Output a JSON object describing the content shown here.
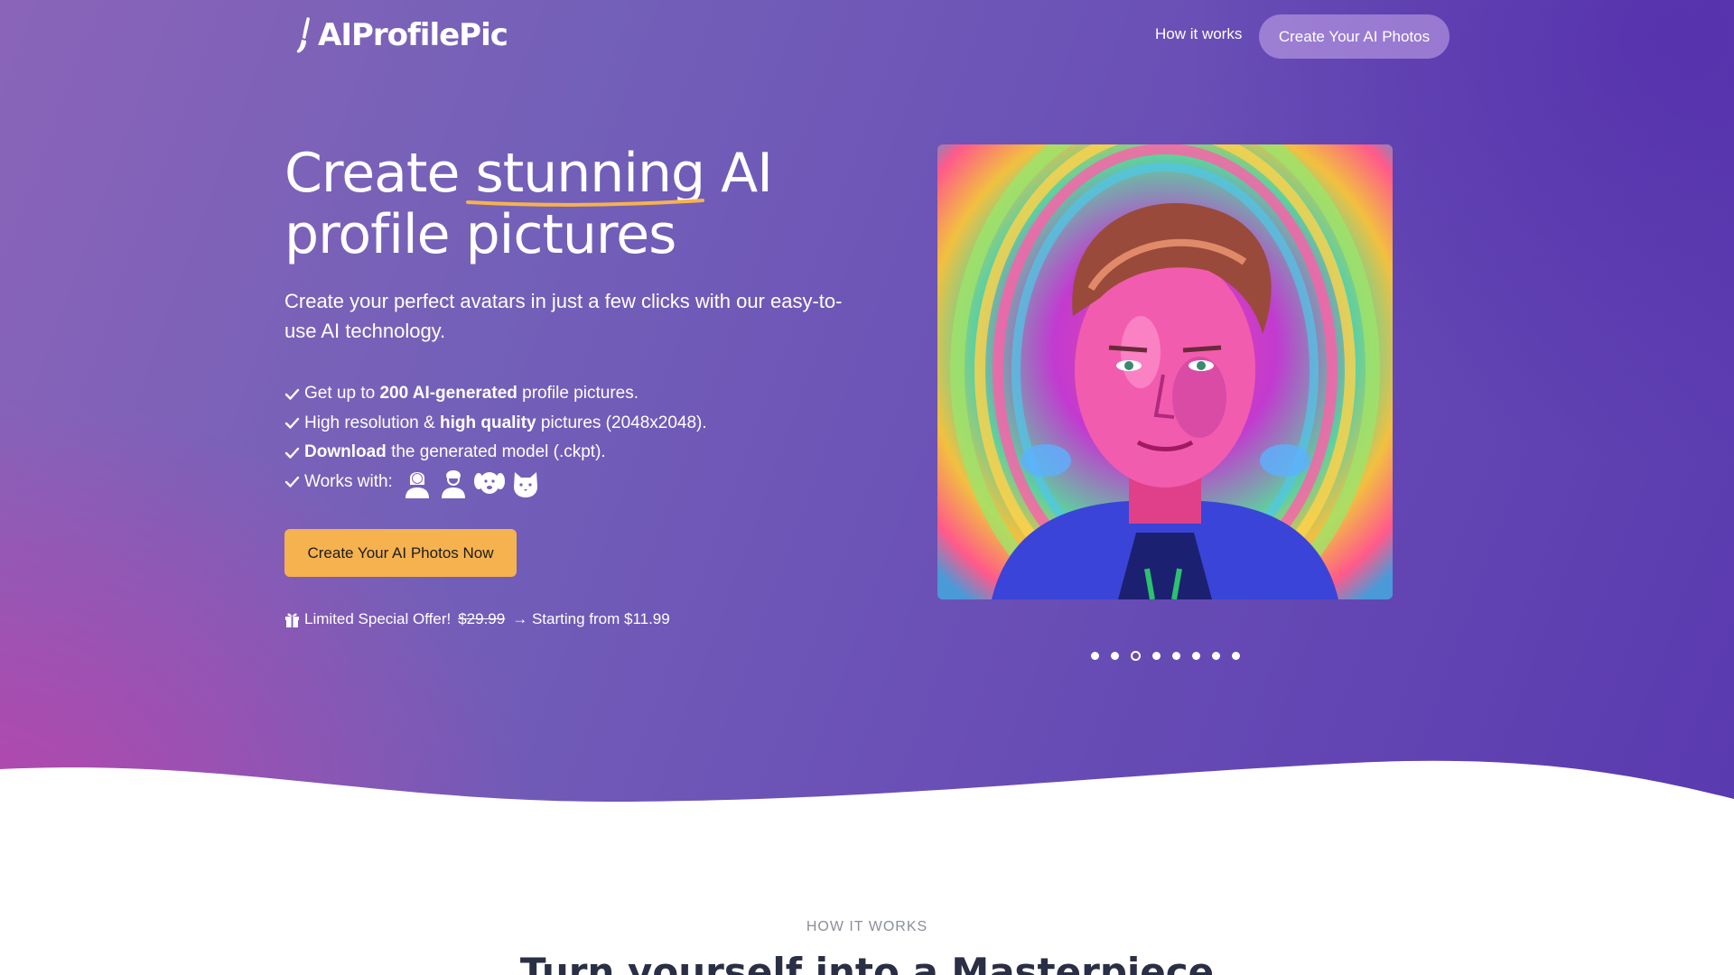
{
  "nav": {
    "logo_text": "AIProfilePic",
    "how_it_works": "How it works",
    "cta": "Create Your AI Photos"
  },
  "hero": {
    "headline_pre": "Create ",
    "headline_em": "stunning",
    "headline_post": " AI",
    "headline_line2": "profile pictures",
    "subhead": "Create your perfect avatars in just a few clicks with our easy-to-use AI technology.",
    "features": {
      "f1_pre": "Get up to ",
      "f1_bold": "200 AI-generated",
      "f1_post": " profile pictures.",
      "f2_pre": "High resolution & ",
      "f2_bold": "high quality",
      "f2_post": " pictures (2048x2048).",
      "f3_bold": "Download",
      "f3_post": " the generated model (.ckpt).",
      "f4": "Works with:"
    },
    "works_with_icons": [
      "woman-icon",
      "man-icon",
      "dog-icon",
      "cat-icon"
    ],
    "cta": "Create Your AI Photos Now",
    "offer_label": "Limited Special Offer!",
    "offer_old_price": "$29.99",
    "offer_arrow": "→",
    "offer_new": "Starting from $11.99",
    "carousel": {
      "slides": 8,
      "active_index": 2
    }
  },
  "section": {
    "eyebrow": "HOW IT WORKS",
    "title": "Turn yourself into a Masterpiece"
  },
  "colors": {
    "accent": "#f6b24f",
    "hero_start": "#8a64b8",
    "hero_end": "#5a3aaf",
    "underline": "#f6b24f"
  }
}
